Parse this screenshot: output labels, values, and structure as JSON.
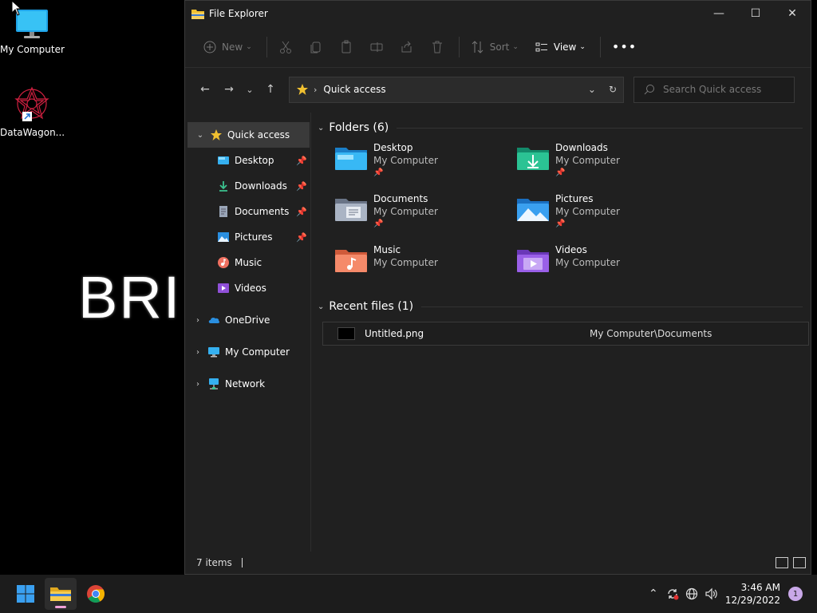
{
  "desktop": {
    "icons": [
      {
        "label": "My Computer"
      },
      {
        "label": "DataWagon..."
      }
    ],
    "wallpaper_text": "BRIN"
  },
  "window": {
    "title": "File Explorer",
    "toolbar": {
      "new_label": "New",
      "sort_label": "Sort",
      "view_label": "View"
    },
    "address": {
      "location": "Quick access"
    },
    "search": {
      "placeholder": "Search Quick access"
    },
    "sidebar": {
      "quick_access": "Quick access",
      "pinned": [
        {
          "label": "Desktop",
          "pinned": true
        },
        {
          "label": "Downloads",
          "pinned": true
        },
        {
          "label": "Documents",
          "pinned": true
        },
        {
          "label": "Pictures",
          "pinned": true
        },
        {
          "label": "Music",
          "pinned": false
        },
        {
          "label": "Videos",
          "pinned": false
        }
      ],
      "onedrive": "OneDrive",
      "my_computer": "My Computer",
      "network": "Network"
    },
    "folders_section": {
      "heading": "Folders (6)",
      "items": [
        {
          "name": "Desktop",
          "location": "My Computer",
          "pinned": true
        },
        {
          "name": "Downloads",
          "location": "My Computer",
          "pinned": true
        },
        {
          "name": "Documents",
          "location": "My Computer",
          "pinned": true
        },
        {
          "name": "Pictures",
          "location": "My Computer",
          "pinned": true
        },
        {
          "name": "Music",
          "location": "My Computer",
          "pinned": false
        },
        {
          "name": "Videos",
          "location": "My Computer",
          "pinned": false
        }
      ]
    },
    "recent_section": {
      "heading": "Recent files (1)",
      "files": [
        {
          "name": "Untitled.png",
          "path": "My Computer\\Documents"
        }
      ]
    },
    "status": {
      "items_count": "7 items"
    }
  },
  "taskbar": {
    "time": "3:46 AM",
    "date": "12/29/2022",
    "notifications": "1"
  },
  "colors": {
    "accent": "#f0c030",
    "window_bg": "#202020",
    "taskbar_bg": "#1c1c1c"
  }
}
